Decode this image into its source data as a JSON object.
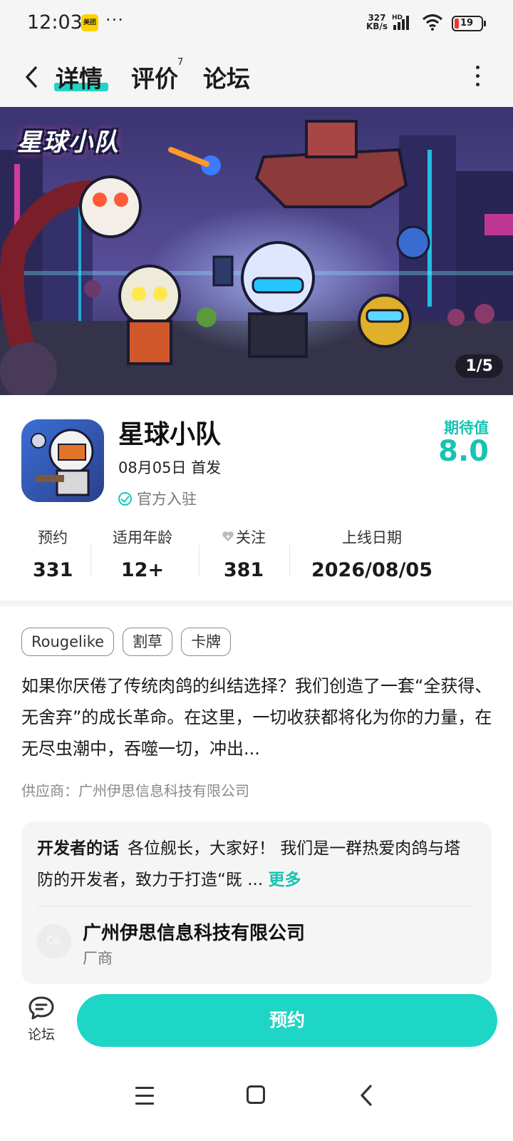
{
  "status_bar": {
    "time": "12:03",
    "app_badge": "美团",
    "dots": "···",
    "net_speed_value": "327",
    "net_speed_unit": "KB/s",
    "hd": "HD",
    "battery": "19",
    "icons": [
      "signal-icon",
      "wifi-icon",
      "battery-icon"
    ]
  },
  "header": {
    "tabs": [
      {
        "label": "详情",
        "active": true
      },
      {
        "label": "评价",
        "count": "7"
      },
      {
        "label": "论坛"
      }
    ],
    "icons": [
      "back-icon",
      "more-icon"
    ]
  },
  "banner": {
    "logo_text": "星球小队",
    "counter": "1/5"
  },
  "app": {
    "name": "星球小队",
    "release": "08月05日 首发",
    "official": "官方入驻",
    "expect_label": "期待值",
    "expect_score": "8.0"
  },
  "stats": [
    {
      "label": "预约",
      "value": "331"
    },
    {
      "label": "适用年龄",
      "value": "12+"
    },
    {
      "label": "关注",
      "value": "381"
    },
    {
      "label": "上线日期",
      "value": "2026/08/05"
    }
  ],
  "tags": [
    "Rougelike",
    "割草",
    "卡牌"
  ],
  "description": "如果你厌倦了传统肉鸽的纠结选择？我们创造了一套“全获得、无舍弃”的成长革命。在这里，一切收获都将化为你的力量，在无尽虫潮中，吞噬一切，冲出...",
  "supplier": "供应商：广州伊思信息科技有限公司",
  "developer": {
    "heading": "开发者的话",
    "text": "各位舰长，大家好！ 我们是一群热爱肉鸽与塔防的开发者，致力于打造“既 ...",
    "more": "更多",
    "company_avatar": "Co.",
    "company_name": "广州伊思信息科技有限公司",
    "company_role": "厂商"
  },
  "bottom_bar": {
    "forum_label": "论坛",
    "reserve_label": "预约"
  },
  "colors": {
    "accent": "#1dd6c5",
    "accent_text": "#17c3b2"
  }
}
